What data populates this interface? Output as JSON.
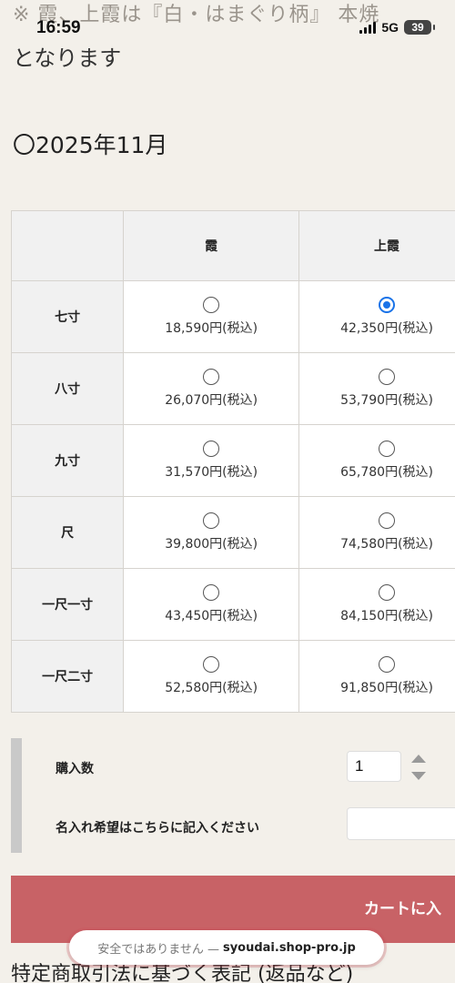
{
  "status_bar": {
    "time": "16:59",
    "network": "5G",
    "battery": "39"
  },
  "notes": {
    "line1": "※ 霞、上霞は『白・はまぐり柄』 本焼",
    "line2": "となります"
  },
  "month_heading": "〇2025年11月",
  "price_table": {
    "columns": [
      "霞",
      "上霞"
    ],
    "rows": [
      {
        "label": "七寸",
        "prices": [
          "18,590円(税込)",
          "42,350円(税込)"
        ],
        "selected": [
          false,
          true
        ]
      },
      {
        "label": "八寸",
        "prices": [
          "26,070円(税込)",
          "53,790円(税込)"
        ],
        "selected": [
          false,
          false
        ]
      },
      {
        "label": "九寸",
        "prices": [
          "31,570円(税込)",
          "65,780円(税込)"
        ],
        "selected": [
          false,
          false
        ]
      },
      {
        "label": "尺",
        "prices": [
          "39,800円(税込)",
          "74,580円(税込)"
        ],
        "selected": [
          false,
          false
        ]
      },
      {
        "label": "一尺一寸",
        "prices": [
          "43,450円(税込)",
          "84,150円(税込)"
        ],
        "selected": [
          false,
          false
        ]
      },
      {
        "label": "一尺二寸",
        "prices": [
          "52,580円(税込)",
          "91,850円(税込)"
        ],
        "selected": [
          false,
          false
        ]
      }
    ]
  },
  "form": {
    "quantity_label": "購入数",
    "quantity_value": "1",
    "engraving_label": "名入れ希望はこちらに記入ください",
    "engraving_value": ""
  },
  "cart_button": {
    "label": "カートに入"
  },
  "url_bar": {
    "warning": "安全ではありません —",
    "domain": "syoudai.shop-pro.jp"
  },
  "bottom_heading": "特定商取引法に基づく表記 (返品など)",
  "colors": {
    "background": "#f3f0ea",
    "cart_button": "#c86266",
    "radio_selected": "#1a73e8"
  }
}
